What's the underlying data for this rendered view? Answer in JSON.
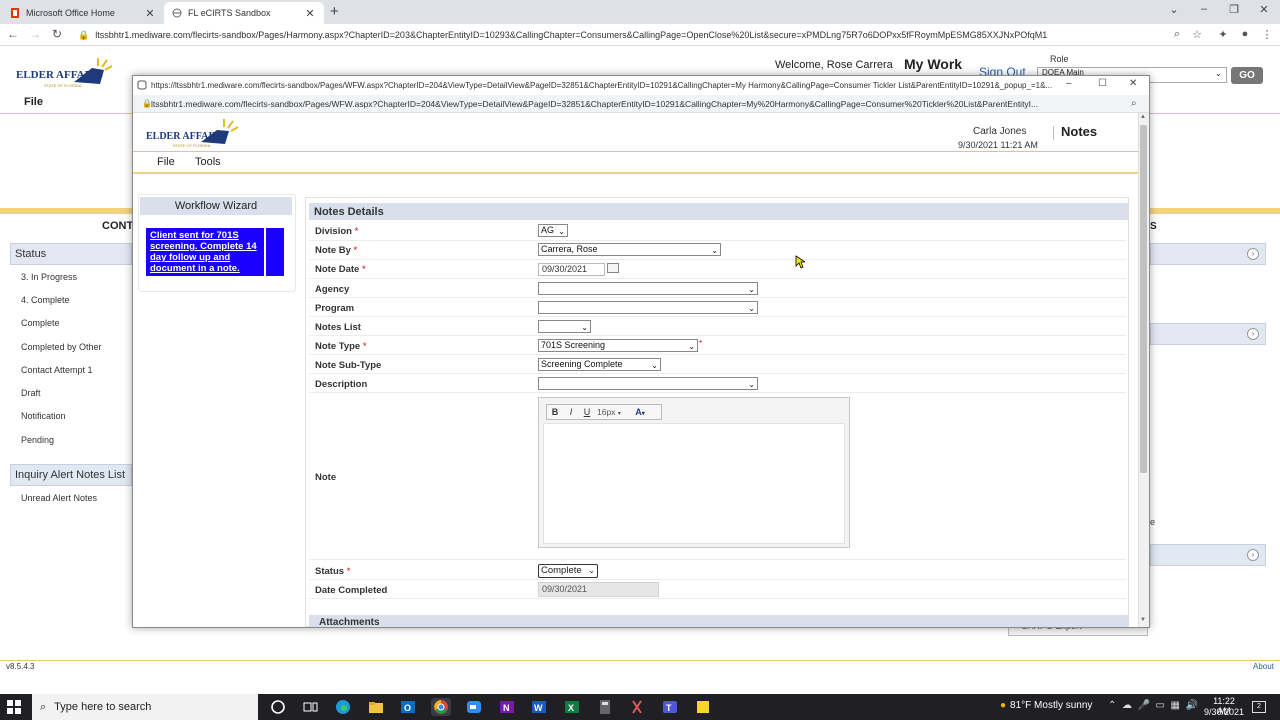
{
  "browser": {
    "tabs": [
      {
        "label": "Microsoft Office Home",
        "active": false
      },
      {
        "label": "FL eCIRTS Sandbox",
        "active": true
      }
    ],
    "url": "ltssbhtr1.mediware.com/flecirts-sandbox/Pages/Harmony.aspx?ChapterID=203&ChapterEntityID=10293&CallingChapter=Consumers&CallingPage=OpenClose%20List&secure=xPMDLng75R7o6DOPxx5fFRoymMpESMG85XXJNxPOfqM1"
  },
  "bg_app": {
    "welcome": "Welcome, Rose Carrera",
    "my_work": "My Work",
    "sign_out": "Sign Out",
    "role_label": "Role",
    "role_value": "DOEA Main",
    "go_label": "GO",
    "menu_file": "File",
    "cont_label": "CONTA",
    "status_header": "Status",
    "status_items": [
      "3. In Progress",
      "4. Complete",
      "Complete",
      "Completed by Other",
      "Contact Attempt 1",
      "Draft",
      "Notification",
      "Pending"
    ],
    "inquiry_header": "Inquiry Alert Notes List",
    "inquiry_items": [
      "Unread Alert Notes"
    ],
    "right_s": "S",
    "right_e": "e",
    "carpo": "CARPO Export",
    "version": "v8.5.4.3",
    "about": "About"
  },
  "popup": {
    "title_url": "https://ltssbhtr1.mediware.com/flecirts-sandbox/Pages/WFW.aspx?ChapterID=204&ViewType=DetailView&PageID=32851&ChapterEntityID=10291&CallingChapter=My Harmony&CallingPage=Consumer Tickler List&ParentEntityID=10291&_popup_=1&...",
    "addr_url": "ltssbhtr1.mediware.com/flecirts-sandbox/Pages/WFW.aspx?ChapterID=204&ViewType=DetailView&PageID=32851&ChapterEntityID=10291&CallingChapter=My%20Harmony&CallingPage=Consumer%20Tickler%20List&ParentEntityI...",
    "user_name": "Carla Jones",
    "page_title": "Notes",
    "datetime": "9/30/2021 11:21 AM",
    "menu_file": "File",
    "menu_tools": "Tools",
    "wizard_title": "Workflow Wizard",
    "wizard_link": "Client sent for 701S screening. Complete 14 day follow up and document in a note.",
    "form_title": "Notes Details",
    "fields": {
      "division": {
        "label": "Division",
        "value": "AG"
      },
      "note_by": {
        "label": "Note By",
        "value": "Carrera, Rose"
      },
      "note_date": {
        "label": "Note Date",
        "value": "09/30/2021"
      },
      "agency": {
        "label": "Agency",
        "value": ""
      },
      "program": {
        "label": "Program",
        "value": ""
      },
      "notes_list": {
        "label": "Notes List",
        "value": ""
      },
      "note_type": {
        "label": "Note Type",
        "value": "701S Screening"
      },
      "note_subtype": {
        "label": "Note Sub-Type",
        "value": "Screening Complete"
      },
      "description": {
        "label": "Description",
        "value": ""
      },
      "note": {
        "label": "Note"
      },
      "status": {
        "label": "Status",
        "value": "Complete"
      },
      "date_completed": {
        "label": "Date Completed",
        "value": "09/30/2021"
      }
    },
    "required_mark": "*",
    "editor": {
      "bold": "B",
      "italic": "I",
      "underline": "U",
      "font_size": "16px",
      "font_color": "A"
    },
    "attachments_title": "Attachments"
  },
  "taskbar": {
    "search_placeholder": "Type here to search",
    "weather": "81°F  Mostly sunny",
    "time": "11:22 AM",
    "date": "9/30/2021",
    "notification_count": "2"
  }
}
